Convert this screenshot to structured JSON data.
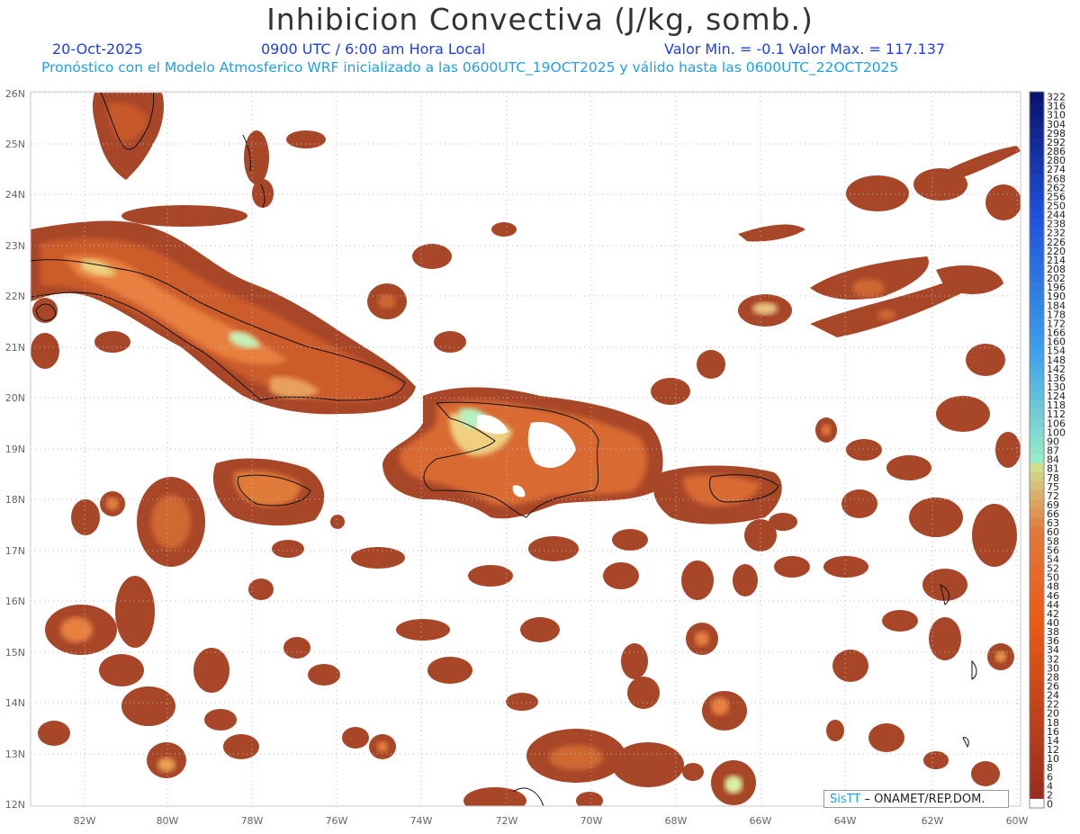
{
  "header": {
    "title": "Inhibicion Convectiva (J/kg, somb.)",
    "date": "20-Oct-2025",
    "time": "0900 UTC / 6:00 am Hora Local",
    "minmax": "Valor Min. = -0.1  Valor Max. = 117.137",
    "description": "Pronóstico con el Modelo Atmosferico WRF inicializado a las 0600UTC_19OCT2025 y válido hasta las  0600UTC_22OCT2025"
  },
  "map": {
    "lat_labels": [
      "26N",
      "25N",
      "24N",
      "23N",
      "22N",
      "21N",
      "20N",
      "19N",
      "18N",
      "17N",
      "16N",
      "15N",
      "14N",
      "13N",
      "12N"
    ],
    "lon_labels": [
      "82W",
      "80W",
      "78W",
      "76W",
      "74W",
      "72W",
      "70W",
      "68W",
      "66W",
      "64W",
      "62W",
      "60W"
    ]
  },
  "colorbar": {
    "labels": [
      "322",
      "316",
      "310",
      "304",
      "298",
      "292",
      "286",
      "280",
      "274",
      "268",
      "262",
      "256",
      "250",
      "244",
      "238",
      "232",
      "226",
      "220",
      "214",
      "208",
      "202",
      "196",
      "190",
      "184",
      "178",
      "172",
      "166",
      "160",
      "154",
      "148",
      "142",
      "136",
      "130",
      "124",
      "118",
      "112",
      "106",
      "100",
      "90",
      "87",
      "84",
      "81",
      "78",
      "75",
      "72",
      "69",
      "66",
      "63",
      "60",
      "58",
      "56",
      "54",
      "52",
      "50",
      "48",
      "46",
      "44",
      "42",
      "40",
      "38",
      "36",
      "34",
      "32",
      "30",
      "28",
      "26",
      "24",
      "22",
      "20",
      "18",
      "16",
      "14",
      "12",
      "10",
      "8",
      "6",
      "4",
      "2",
      "0"
    ]
  },
  "credit": {
    "brand": "SisTT",
    "text": "– ONAMET/REP.DOM."
  }
}
